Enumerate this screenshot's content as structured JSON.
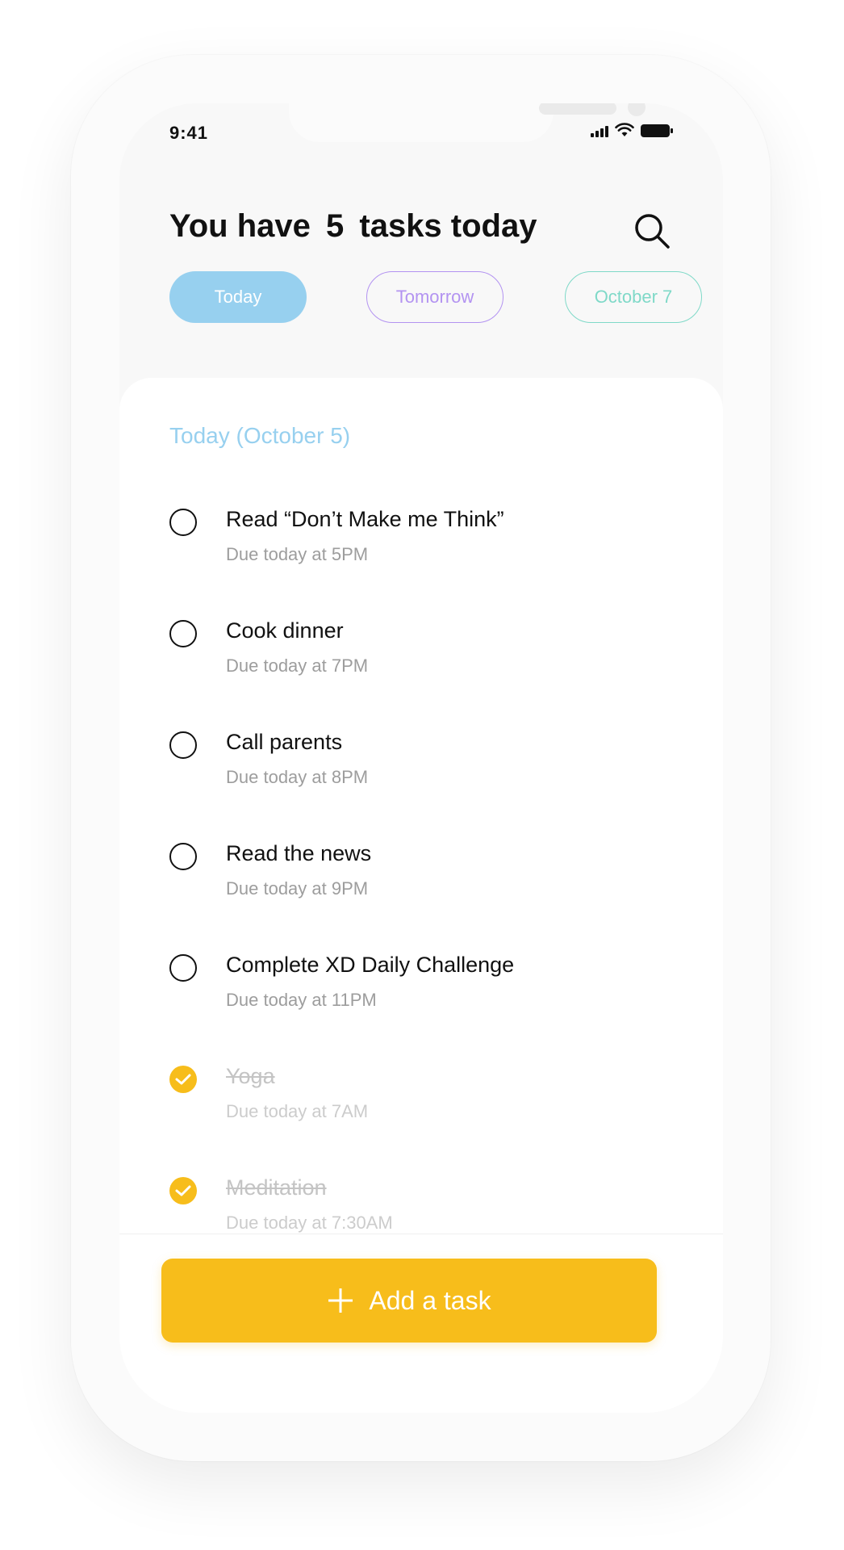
{
  "status_bar": {
    "time": "9:41"
  },
  "header": {
    "title_prefix": "You have",
    "task_count": "5",
    "title_suffix": "tasks today"
  },
  "tabs": [
    {
      "label": "Today",
      "active": true,
      "color": "#97d0ef"
    },
    {
      "label": "Tomorrow",
      "active": false,
      "color": "#b393f1"
    },
    {
      "label": "October 7",
      "active": false,
      "color": "#7fd9c8"
    }
  ],
  "section": {
    "title": "Today (October 5)"
  },
  "tasks": [
    {
      "title": "Read “Don’t Make me Think”",
      "due": "Due today at 5PM",
      "done": false
    },
    {
      "title": "Cook dinner",
      "due": "Due today at 7PM",
      "done": false
    },
    {
      "title": "Call parents",
      "due": "Due today at 8PM",
      "done": false
    },
    {
      "title": "Read the news",
      "due": "Due today at 9PM",
      "done": false
    },
    {
      "title": "Complete XD Daily Challenge",
      "due": "Due today at 11PM",
      "done": false
    },
    {
      "title": "Yoga",
      "due": "Due today at 7AM",
      "done": true
    },
    {
      "title": "Meditation",
      "due": "Due today at 7:30AM",
      "done": true
    }
  ],
  "footer": {
    "add_label": "Add a task",
    "accent_color": "#f7bd1b"
  },
  "icons": {
    "search": "search-icon",
    "plus": "plus-icon",
    "check": "check-icon",
    "signal": "signal-icon",
    "wifi": "wifi-icon",
    "battery": "battery-icon"
  }
}
